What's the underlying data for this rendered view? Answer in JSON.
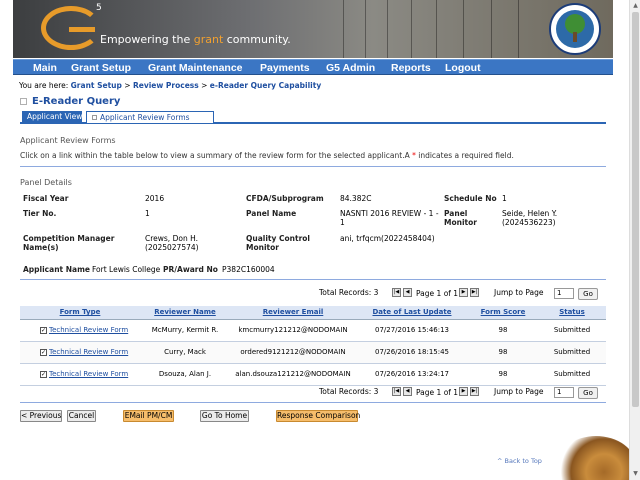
{
  "branding": {
    "logo_superscript": "5",
    "tagline_pre": "Empowering the ",
    "tagline_accent": "grant",
    "tagline_post": " community."
  },
  "nav": [
    "Main",
    "Grant Setup",
    "Grant Maintenance",
    "Payments",
    "G5 Admin",
    "Reports",
    "Logout"
  ],
  "breadcrumb": {
    "prefix": "You are here:",
    "items": [
      "Grant Setup",
      "Review Process",
      "e-Reader Query Capability"
    ],
    "sep": " > "
  },
  "page_title": "E-Reader Query",
  "tabs": [
    "Applicant View",
    "Applicant Review Forms"
  ],
  "section_title": "Applicant Review Forms",
  "hint": {
    "text": "Click on a link within the table below to view a summary of the review form for the selected applicant.A ",
    "req": "*",
    "tail": " indicates a required field."
  },
  "panel": {
    "heading": "Panel Details",
    "fiscal_year": {
      "label": "Fiscal Year",
      "value": "2016"
    },
    "cfda": {
      "label": "CFDA/Subprogram",
      "value": "84.382C"
    },
    "schedule": {
      "label": "Schedule No",
      "value": "1"
    },
    "tier": {
      "label": "Tier No.",
      "value": "1"
    },
    "panel_name": {
      "label": "Panel Name",
      "value_1": "NASNTI 2016 REVIEW - 1 -",
      "value_2": "1"
    },
    "panel_monitor": {
      "label_1": "Panel",
      "label_2": "Monitor",
      "value_1": "Seide, Helen Y.",
      "value_2": "(2024536223)"
    },
    "competition_manager": {
      "label_1": "Competition Manager",
      "label_2": "Name(s)",
      "value_1": "Crews, Don H.",
      "value_2": "(2025027574)"
    },
    "qc_monitor": {
      "label_1": "Quality Control",
      "label_2": "Monitor",
      "value": "ani, trfqcm(2022458404)"
    }
  },
  "applicant": {
    "label": "Applicant Name",
    "value": "Fort Lewis College",
    "award_label": "PR/Award No",
    "award_value": "P382C160004"
  },
  "pager": {
    "total": "Total Records: 3",
    "page": "Page 1 of 1",
    "jump_label": "Jump to Page",
    "jump_value": "1",
    "go": "Go",
    "first": "|◀",
    "prev": "◀",
    "next": "▶",
    "last": "▶|"
  },
  "table": {
    "headers": [
      "Form Type",
      "Reviewer Name",
      "Reviewer Email",
      "Date of Last Update",
      "Form Score",
      "Status"
    ],
    "rows": [
      {
        "form": "Technical Review Form",
        "name": "McMurry, Kermit R.",
        "email": "kmcmurry121212@NODOMAIN",
        "date": "07/27/2016 15:46:13",
        "score": "98",
        "status": "Submitted"
      },
      {
        "form": "Technical Review Form",
        "name": "Curry, Mack",
        "email": "ordered9121212@NODOMAIN",
        "date": "07/26/2016 18:15:45",
        "score": "98",
        "status": "Submitted"
      },
      {
        "form": "Technical Review Form",
        "name": "Dsouza, Alan J.",
        "email": "alan.dsouza121212@NODOMAIN",
        "date": "07/26/2016 13:24:17",
        "score": "98",
        "status": "Submitted"
      }
    ]
  },
  "buttons": {
    "previous": "< Previous",
    "cancel": "Cancel",
    "email": "EMail PM/CM",
    "home": "Go To Home",
    "compare": "Response Comparison"
  },
  "back_to_top": "^ Back to Top",
  "colors": {
    "nav": "#3b76c4",
    "link": "#1f4fa0",
    "accent_button": "#f6bd6b",
    "tab_active": "#2b65b4"
  }
}
